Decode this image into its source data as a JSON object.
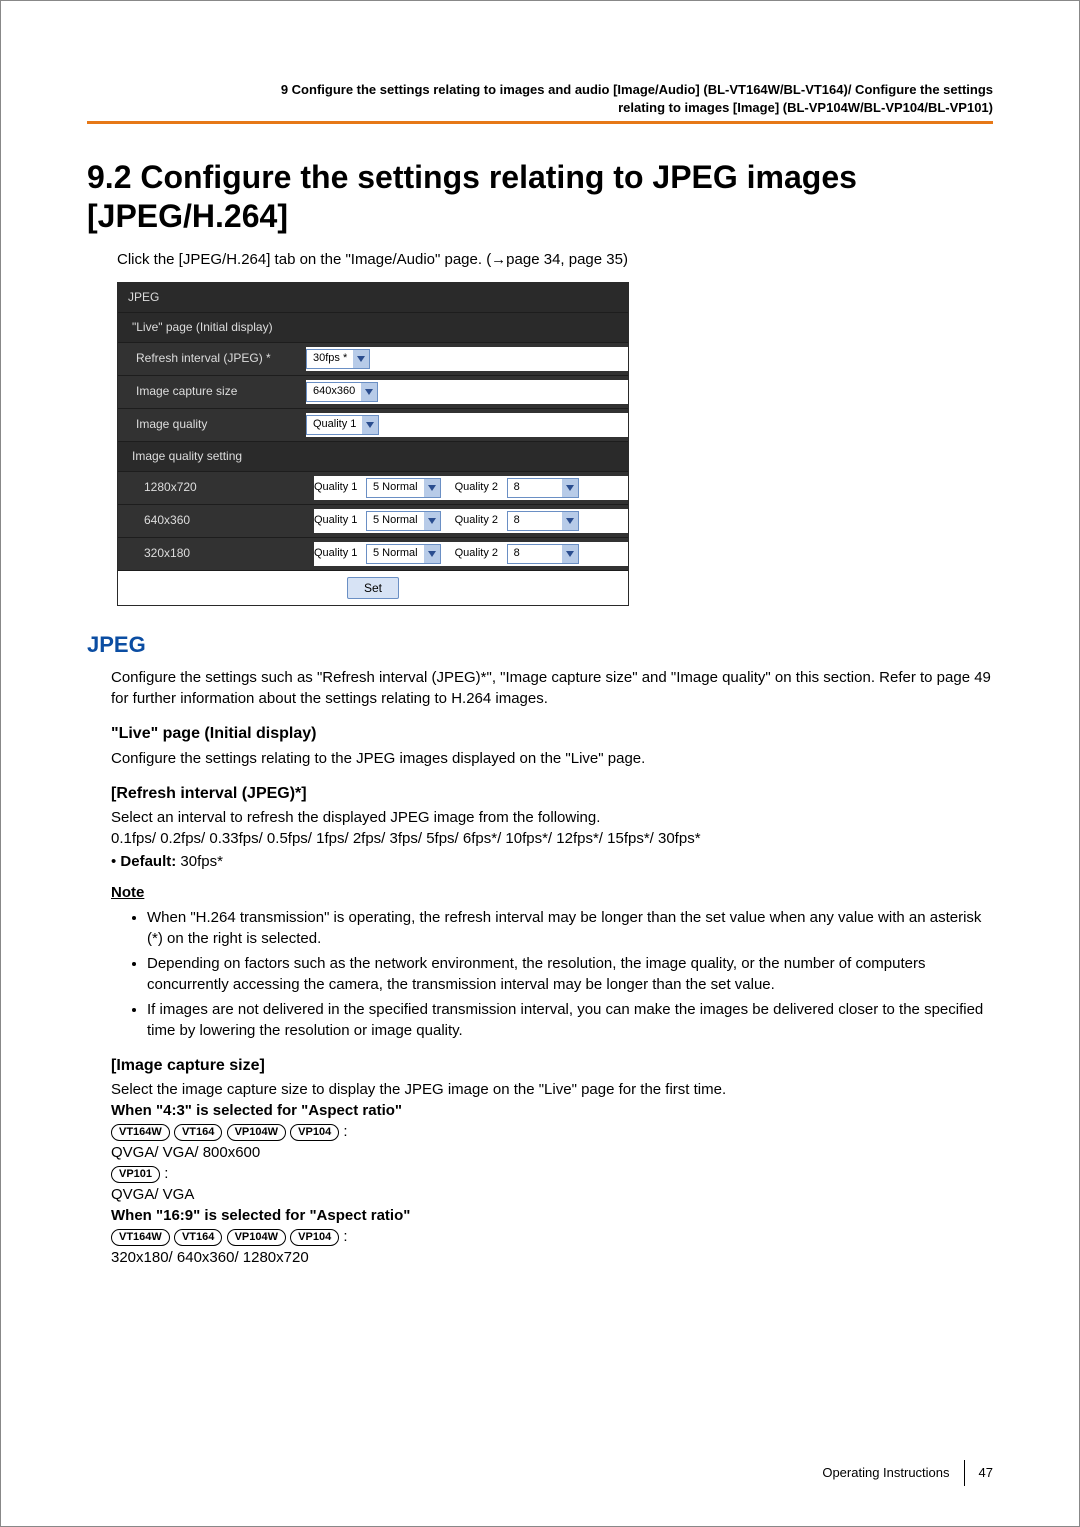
{
  "header": {
    "line1": "9 Configure the settings relating to images and audio [Image/Audio] (BL-VT164W/BL-VT164)/ Configure the settings",
    "line2": "relating to images [Image] (BL-VP104W/BL-VP104/BL-VP101)"
  },
  "title": "9.2  Configure the settings relating to JPEG images [JPEG/H.264]",
  "intro": "Click the [JPEG/H.264] tab on the \"Image/Audio\" page. (→page 34, page 35)",
  "panel": {
    "group_title": "JPEG",
    "live_title": "\"Live\" page (Initial display)",
    "refresh_label": "Refresh interval (JPEG) *",
    "refresh_value": "30fps *",
    "size_label": "Image capture size",
    "size_value": "640x360",
    "quality_label": "Image quality",
    "quality_value": "Quality 1",
    "iqs_title": "Image quality setting",
    "rows": [
      {
        "res": "1280x720",
        "q1_label": "Quality 1",
        "q1": "5 Normal",
        "q2_label": "Quality 2",
        "q2": "8"
      },
      {
        "res": "640x360",
        "q1_label": "Quality 1",
        "q1": "5 Normal",
        "q2_label": "Quality 2",
        "q2": "8"
      },
      {
        "res": "320x180",
        "q1_label": "Quality 1",
        "q1": "5 Normal",
        "q2_label": "Quality 2",
        "q2": "8"
      }
    ],
    "set_button": "Set"
  },
  "jpeg_heading": "JPEG",
  "jpeg_para": "Configure the settings such as \"Refresh interval (JPEG)*\", \"Image capture size\" and \"Image quality\" on this section. Refer to page 49 for further information about the settings relating to H.264 images.",
  "live_h": "\"Live\" page (Initial display)",
  "live_p": "Configure the settings relating to the JPEG images displayed on the \"Live\" page.",
  "refresh_h": "[Refresh interval (JPEG)*]",
  "refresh_p1": "Select an interval to refresh the displayed JPEG image from the following.",
  "refresh_p2": "0.1fps/ 0.2fps/ 0.33fps/ 0.5fps/ 1fps/ 2fps/ 3fps/ 5fps/ 6fps*/ 10fps*/ 12fps*/ 15fps*/ 30fps*",
  "default_label": "Default:",
  "default_value": " 30fps*",
  "note_label": "Note",
  "notes": [
    "When \"H.264 transmission\" is operating, the refresh interval may be longer than the set value when any value with an asterisk (*) on the right is selected.",
    "Depending on factors such as the network environment, the resolution, the image quality, or the number of computers concurrently accessing the camera, the transmission interval may be longer than the set value.",
    "If images are not delivered in the specified transmission interval, you can make the images be delivered closer to the specified time by lowering the resolution or image quality."
  ],
  "ics_h": "[Image capture size]",
  "ics_p": "Select the image capture size to display the JPEG image on the \"Live\" page for the first time.",
  "ics_when43": "When \"4:3\" is selected for \"Aspect ratio\"",
  "badges4": [
    "VT164W",
    "VT164",
    "VP104W",
    "VP104"
  ],
  "ics_43_vals": "QVGA/ VGA/ 800x600",
  "badge_vp101": "VP101",
  "ics_43_vals2": "QVGA/ VGA",
  "ics_when169": "When \"16:9\" is selected for \"Aspect ratio\"",
  "ics_169_vals": "320x180/ 640x360/ 1280x720",
  "footer": {
    "label": "Operating Instructions",
    "page": "47"
  }
}
